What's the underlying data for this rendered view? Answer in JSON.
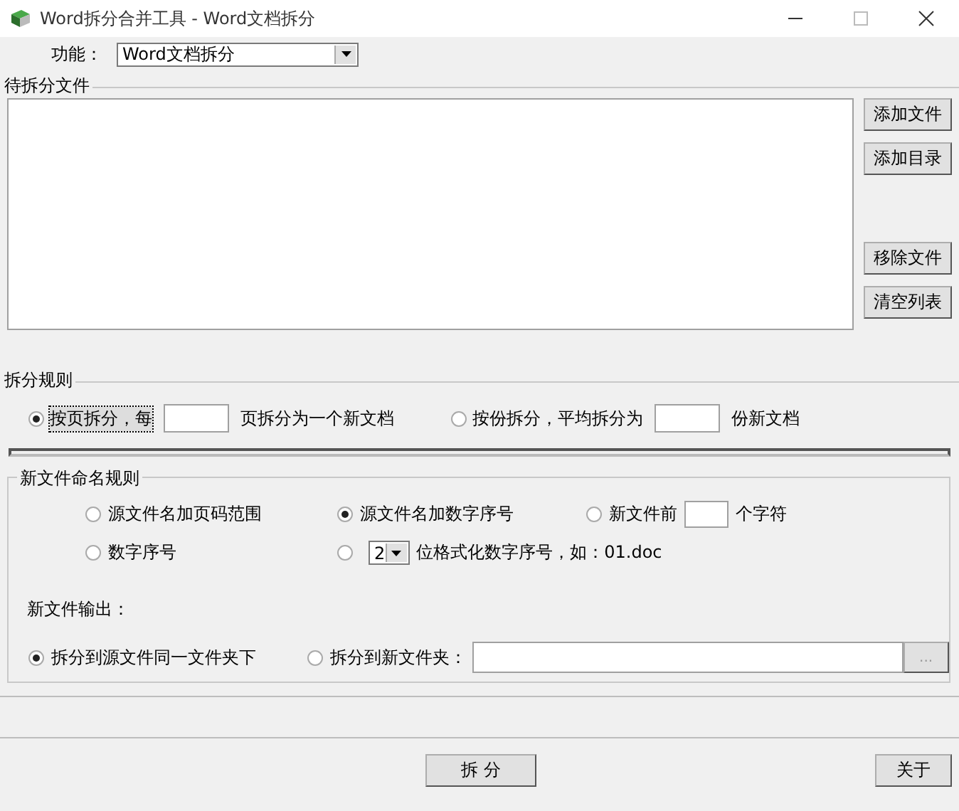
{
  "window": {
    "title": "Word拆分合并工具 - Word文档拆分"
  },
  "function": {
    "label": "功能：",
    "value": "Word文档拆分"
  },
  "file_list": {
    "title": "待拆分文件",
    "buttons": [
      "添加文件",
      "添加目录",
      "移除文件",
      "清空列表"
    ]
  },
  "split_rule": {
    "title": "拆分规则",
    "options": [
      {
        "before": "按页拆分，每",
        "after": "页拆分为一个新文档",
        "selected": true,
        "focused": true
      },
      {
        "before": "按份拆分，平均拆分为",
        "after": "份新文档",
        "selected": false,
        "focused": false
      }
    ]
  },
  "naming": {
    "title": "新文件命名规则",
    "options": [
      {
        "kind": "text",
        "label": "源文件名加页码范围",
        "selected": false
      },
      {
        "kind": "text",
        "label": "源文件名加数字序号",
        "selected": true
      },
      {
        "kind": "field",
        "before": "新文件前",
        "after": "个字符",
        "selected": false
      },
      {
        "kind": "text",
        "label": "数字序号",
        "selected": false
      },
      {
        "kind": "select",
        "value": "2",
        "after": "位格式化数字序号，如：01.doc",
        "selected": false
      }
    ]
  },
  "output": {
    "label": "新文件输出：",
    "options": [
      {
        "kind": "text",
        "label": "拆分到源文件同一文件夹下",
        "selected": true
      },
      {
        "kind": "folder",
        "label": "拆分到新文件夹：",
        "selected": false
      }
    ],
    "browse": "..."
  },
  "buttons": [
    "拆 分",
    "关于"
  ]
}
